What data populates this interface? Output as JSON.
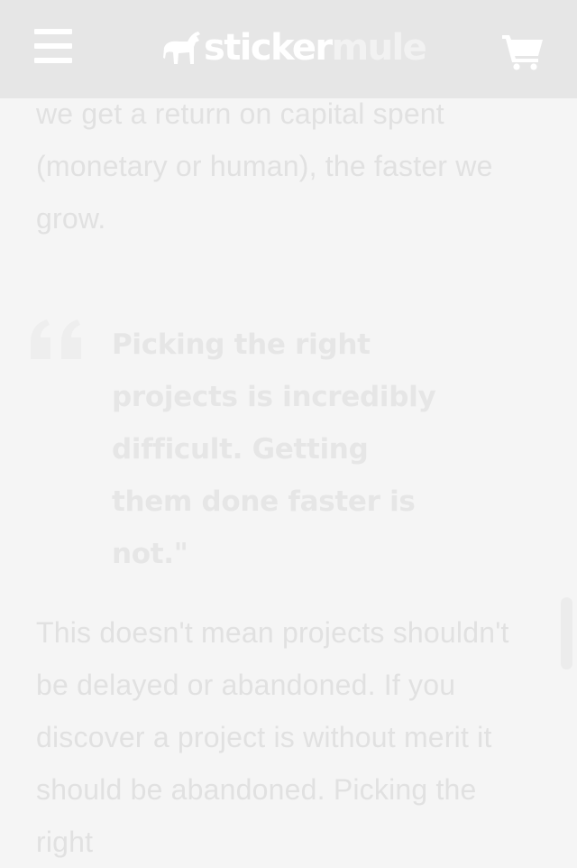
{
  "header": {
    "menu_icon": "hamburger-menu-icon",
    "logo": {
      "icon": "mule-icon",
      "word1": "sticker",
      "word2": "mule"
    },
    "cart_icon": "shopping-cart-icon",
    "background": "#e6e6e6"
  },
  "article": {
    "paragraph_top": "we get a return on capital spent (monetary or human), the faster we grow.",
    "quote": {
      "icon": "quote-mark-icon",
      "text": "Picking the right projects is incredibly difficult. Getting them done faster is not.\""
    },
    "paragraph_bottom": "This doesn't mean projects shouldn't be delayed or abandoned. If you discover a project is without merit it should be abandoned. Picking the right"
  },
  "colors": {
    "page_background": "#f5f5f5",
    "body_text": "#e1e1e1",
    "quote_text": "#e6e6e6"
  }
}
